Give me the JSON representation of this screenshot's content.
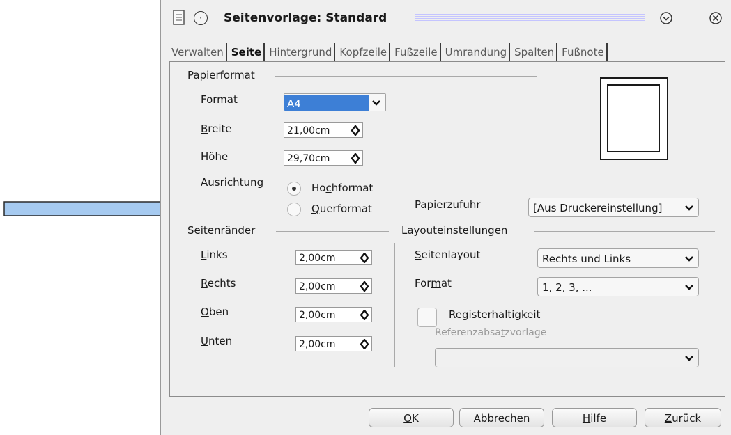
{
  "window": {
    "title": "Seitenvorlage: Standard"
  },
  "tabs": [
    {
      "label": "Verwalten",
      "active": false
    },
    {
      "label": "Seite",
      "active": true
    },
    {
      "label": "Hintergrund",
      "active": false
    },
    {
      "label": "Kopfzeile",
      "active": false
    },
    {
      "label": "Fußzeile",
      "active": false
    },
    {
      "label": "Umrandung",
      "active": false
    },
    {
      "label": "Spalten",
      "active": false
    },
    {
      "label": "Fußnote",
      "active": false
    }
  ],
  "paper_format": {
    "group_title": "Papierformat",
    "format_label_pre": "",
    "format_label_key": "F",
    "format_label_post": "ormat",
    "format_value": "A4",
    "width_label_key": "B",
    "width_label_post": "reite",
    "width_value": "21,00cm",
    "height_label_pre": "Höh",
    "height_label_key": "e",
    "height_value": "29,70cm",
    "orientation_label": "Ausrichtung",
    "portrait_pre": "Ho",
    "portrait_key": "c",
    "portrait_post": "hformat",
    "landscape_key": "Q",
    "landscape_post": "uerformat",
    "orientation_selected": "portrait",
    "paper_tray_key": "P",
    "paper_tray_post": "apierzufuhr",
    "paper_tray_value": "[Aus Druckereinstellung]"
  },
  "margins": {
    "group_title": "Seitenränder",
    "left_key": "L",
    "left_post": "inks",
    "left_value": "2,00cm",
    "right_key": "R",
    "right_post": "echts",
    "right_value": "2,00cm",
    "top_key": "O",
    "top_post": "ben",
    "top_value": "2,00cm",
    "bottom_key": "U",
    "bottom_post": "nten",
    "bottom_value": "2,00cm"
  },
  "layout": {
    "group_title": "Layouteinstellungen",
    "page_layout_key": "S",
    "page_layout_post": "eitenlayout",
    "page_layout_value": "Rechts und Links",
    "format_pre": "For",
    "format_key": "m",
    "format_post": "at",
    "format_value": "1, 2, 3, ...",
    "register_pre": "Registerhaltig",
    "register_key": "k",
    "register_post": "eit",
    "reference_pre": "Referenzabsa",
    "reference_key": "t",
    "reference_post": "zvorlage",
    "reference_value": ""
  },
  "buttons": {
    "ok_key": "O",
    "ok_post": "K",
    "cancel": "Abbrechen",
    "help_key": "H",
    "help_post": "ilfe",
    "back_key": "Z",
    "back_post": "urück"
  },
  "colors": {
    "arrow_fill": "#a6caf0",
    "selection": "#3d7fd6",
    "title_lines": "#c4c4ff"
  }
}
